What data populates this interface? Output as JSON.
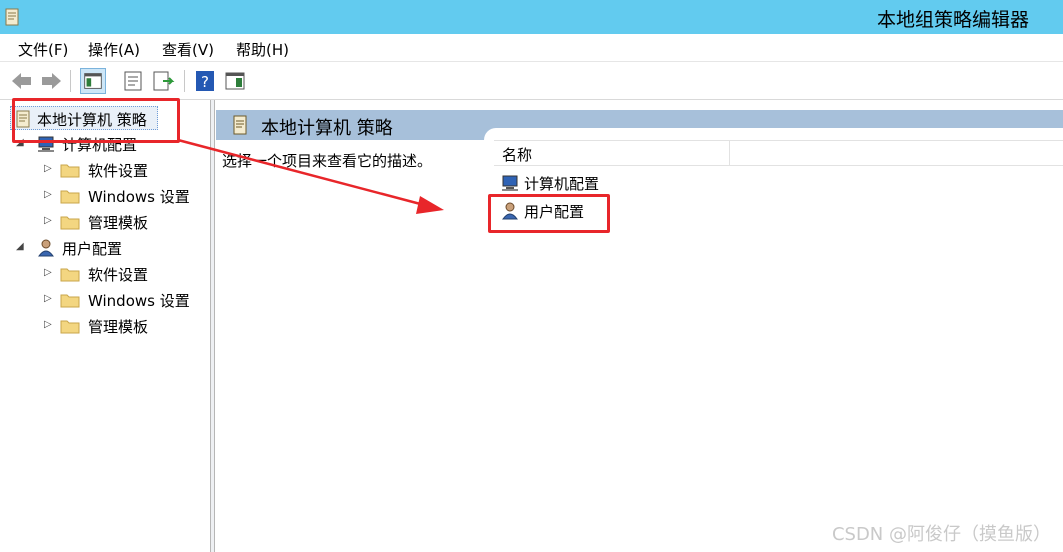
{
  "window": {
    "title": "本地组策略编辑器"
  },
  "menu": {
    "file": "文件(F)",
    "action": "操作(A)",
    "view": "查看(V)",
    "help": "帮助(H)"
  },
  "toolbar": {
    "buttons": [
      "back-icon",
      "forward-icon",
      "show-hide-tree-icon",
      "properties-icon",
      "export-list-icon",
      "help-icon",
      "show-hide-action-pane-icon"
    ]
  },
  "tree": {
    "root": "本地计算机 策略",
    "computer_config": "计算机配置",
    "user_config": "用户配置",
    "children": {
      "software": "软件设置",
      "windows": "Windows 设置",
      "admin": "管理模板"
    }
  },
  "right": {
    "header": "本地计算机 策略",
    "description": "选择一个项目来查看它的描述。",
    "column_name": "名称",
    "items": [
      "计算机配置",
      "用户配置"
    ]
  },
  "colors": {
    "titlebar": "#62cbef",
    "header": "#a7c0da",
    "annotation": "#e8262a"
  },
  "watermark": "CSDN @阿俊仔（摸鱼版）"
}
